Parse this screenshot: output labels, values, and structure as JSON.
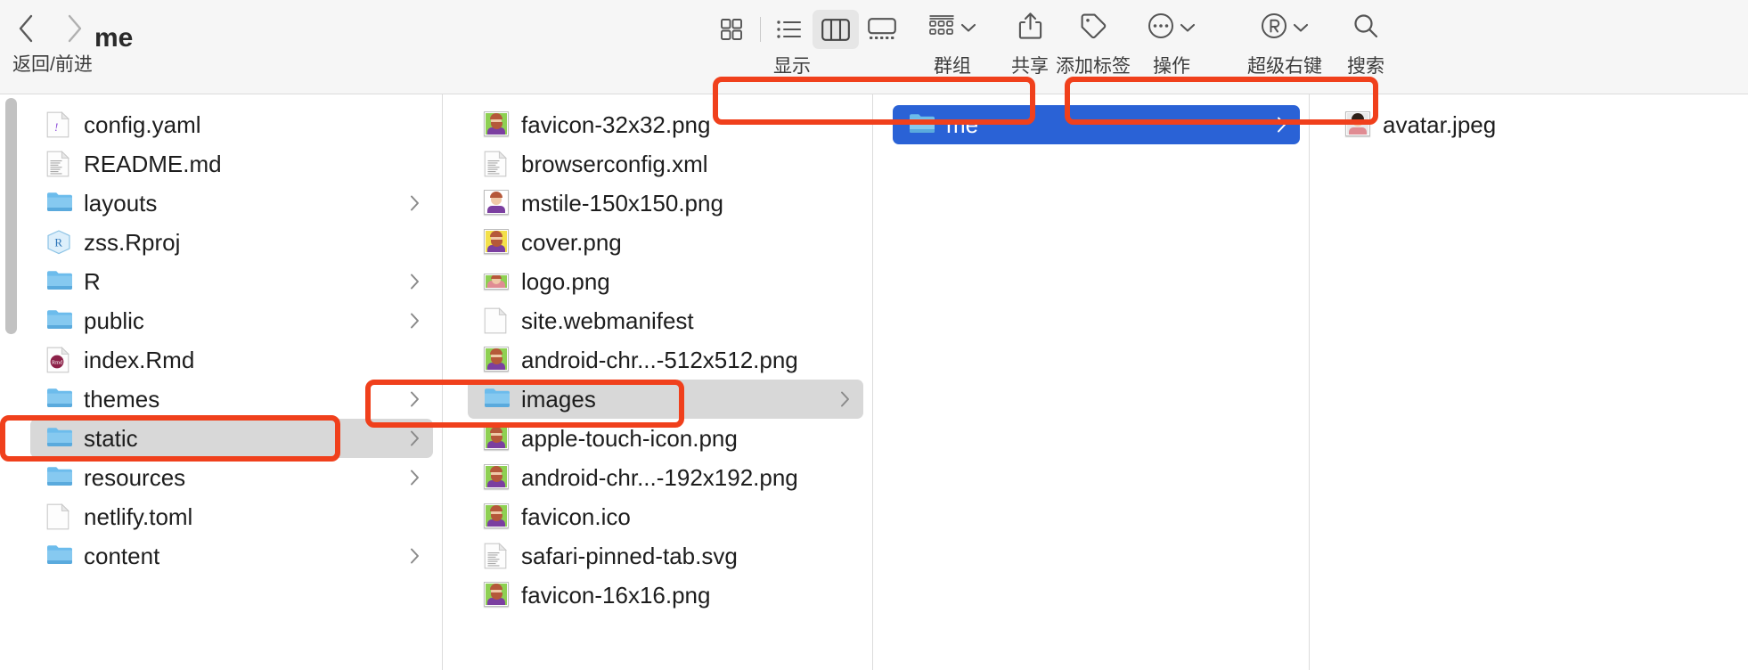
{
  "window": {
    "title": "me",
    "nav_label": "返回/前进",
    "back_icon": "chevron-left-icon",
    "forward_icon": "chevron-right-icon"
  },
  "toolbar": {
    "view_label": "显示",
    "view_modes": [
      {
        "name": "icon-view",
        "icon": "grid-icon",
        "active": false
      },
      {
        "name": "list-view",
        "icon": "list-icon",
        "active": false
      },
      {
        "name": "column-view",
        "icon": "columns-icon",
        "active": true
      },
      {
        "name": "gallery-view",
        "icon": "gallery-icon",
        "active": false
      }
    ],
    "items": [
      {
        "name": "group-button",
        "label": "群组",
        "icon": "group-grid-icon",
        "caret": true
      },
      {
        "name": "share-button",
        "label": "共享",
        "icon": "share-icon",
        "caret": false
      },
      {
        "name": "tag-button",
        "label": "添加标签",
        "icon": "tag-icon",
        "caret": false
      },
      {
        "name": "action-button",
        "label": "操作",
        "icon": "ellipsis-circle-icon",
        "caret": true
      },
      {
        "name": "superright-button",
        "label": "超级右键",
        "icon": "r-circle-icon",
        "caret": true
      },
      {
        "name": "search-button",
        "label": "搜索",
        "icon": "search-icon",
        "caret": false
      }
    ]
  },
  "colors": {
    "selection_blue": "#2a62d6",
    "selection_gray": "#d8d8d8",
    "annotation_red": "#f0401c",
    "toolbar_bg": "#f6f6f6"
  },
  "columns": [
    {
      "name": "column-1",
      "items": [
        {
          "label": "config.yaml",
          "icon": "yaml-file-icon",
          "kind": "file",
          "arrow": false,
          "state": "none"
        },
        {
          "label": "README.md",
          "icon": "text-file-icon",
          "kind": "file",
          "arrow": false,
          "state": "none"
        },
        {
          "label": "layouts",
          "icon": "folder-icon",
          "kind": "folder",
          "arrow": true,
          "state": "none"
        },
        {
          "label": "zss.Rproj",
          "icon": "rproj-file-icon",
          "kind": "file",
          "arrow": false,
          "state": "none"
        },
        {
          "label": "R",
          "icon": "folder-icon",
          "kind": "folder",
          "arrow": true,
          "state": "none"
        },
        {
          "label": "public",
          "icon": "folder-icon",
          "kind": "folder",
          "arrow": true,
          "state": "none"
        },
        {
          "label": "index.Rmd",
          "icon": "rmd-file-icon",
          "kind": "file",
          "arrow": false,
          "state": "none"
        },
        {
          "label": "themes",
          "icon": "folder-icon",
          "kind": "folder",
          "arrow": true,
          "state": "none"
        },
        {
          "label": "static",
          "icon": "folder-icon",
          "kind": "folder",
          "arrow": true,
          "state": "gray"
        },
        {
          "label": "resources",
          "icon": "folder-icon",
          "kind": "folder",
          "arrow": true,
          "state": "none"
        },
        {
          "label": "netlify.toml",
          "icon": "blank-file-icon",
          "kind": "file",
          "arrow": false,
          "state": "none"
        },
        {
          "label": "content",
          "icon": "folder-icon",
          "kind": "folder",
          "arrow": true,
          "state": "none"
        }
      ]
    },
    {
      "name": "column-2",
      "items": [
        {
          "label": "favicon-32x32.png",
          "icon": "image-thumb-green",
          "kind": "image",
          "arrow": false,
          "state": "none"
        },
        {
          "label": "browserconfig.xml",
          "icon": "text-file-icon",
          "kind": "file",
          "arrow": false,
          "state": "none"
        },
        {
          "label": "mstile-150x150.png",
          "icon": "image-thumb-white",
          "kind": "image",
          "arrow": false,
          "state": "none"
        },
        {
          "label": "cover.png",
          "icon": "image-thumb-yellow",
          "kind": "image",
          "arrow": false,
          "state": "none"
        },
        {
          "label": "logo.png",
          "icon": "image-thumb-wide",
          "kind": "image",
          "arrow": false,
          "state": "none"
        },
        {
          "label": "site.webmanifest",
          "icon": "blank-file-icon",
          "kind": "file",
          "arrow": false,
          "state": "none"
        },
        {
          "label": "android-chr...-512x512.png",
          "icon": "image-thumb-green",
          "kind": "image",
          "arrow": false,
          "state": "none"
        },
        {
          "label": "images",
          "icon": "folder-icon",
          "kind": "folder",
          "arrow": true,
          "state": "gray"
        },
        {
          "label": "apple-touch-icon.png",
          "icon": "image-thumb-green",
          "kind": "image",
          "arrow": false,
          "state": "none"
        },
        {
          "label": "android-chr...-192x192.png",
          "icon": "image-thumb-green",
          "kind": "image",
          "arrow": false,
          "state": "none"
        },
        {
          "label": "favicon.ico",
          "icon": "image-thumb-green",
          "kind": "image",
          "arrow": false,
          "state": "none"
        },
        {
          "label": "safari-pinned-tab.svg",
          "icon": "text-file-icon",
          "kind": "file",
          "arrow": false,
          "state": "none"
        },
        {
          "label": "favicon-16x16.png",
          "icon": "image-thumb-green",
          "kind": "image",
          "arrow": false,
          "state": "none"
        }
      ]
    },
    {
      "name": "column-3",
      "items": [
        {
          "label": "me",
          "icon": "folder-icon",
          "kind": "folder",
          "arrow": true,
          "state": "blue"
        }
      ]
    },
    {
      "name": "column-4",
      "items": [
        {
          "label": "avatar.jpeg",
          "icon": "image-thumb-face",
          "kind": "image",
          "arrow": false,
          "state": "none"
        }
      ]
    }
  ],
  "annotations": [
    {
      "name": "annotation-static",
      "target": "static"
    },
    {
      "name": "annotation-images",
      "target": "images"
    },
    {
      "name": "annotation-me",
      "target": "me"
    },
    {
      "name": "annotation-avatar",
      "target": "avatar.jpeg"
    }
  ]
}
